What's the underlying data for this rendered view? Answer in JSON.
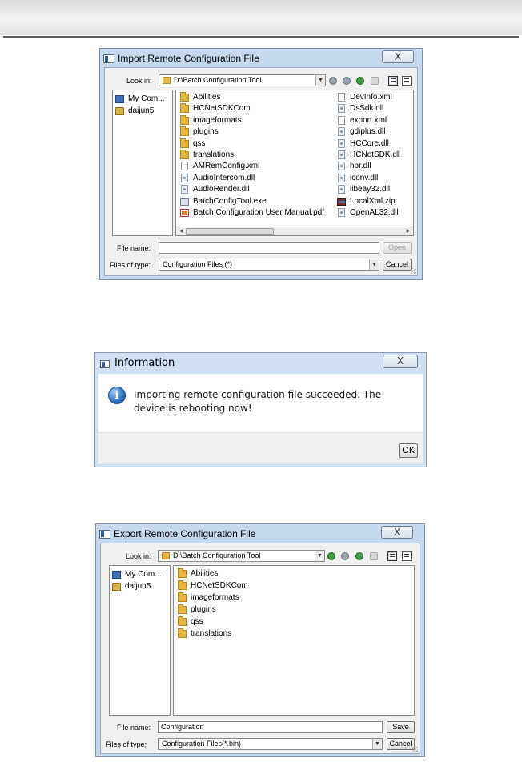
{
  "import_dialog": {
    "title": "Import Remote Configuration File",
    "close_glyph": "X",
    "look_in_label": "Look in:",
    "look_in_value": "D:\\Batch Configuration Tool",
    "sidebar": [
      "My Com...",
      "daijun5"
    ],
    "files_col1": [
      {
        "name": "Abilities",
        "icon": "folder-icon"
      },
      {
        "name": "HCNetSDKCom",
        "icon": "folder-icon"
      },
      {
        "name": "imageformats",
        "icon": "folder-icon"
      },
      {
        "name": "plugins",
        "icon": "folder-icon"
      },
      {
        "name": "qss",
        "icon": "folder-icon"
      },
      {
        "name": "translations",
        "icon": "folder-icon"
      },
      {
        "name": "AMRemConfig.xml",
        "icon": "file-icon"
      },
      {
        "name": "AudioIntercom.dll",
        "icon": "dll-icon"
      },
      {
        "name": "AudioRender.dll",
        "icon": "dll-icon"
      },
      {
        "name": "BatchConfigTool.exe",
        "icon": "exe-icon"
      },
      {
        "name": "Batch Configuration User Manual.pdf",
        "icon": "pdf-icon"
      }
    ],
    "files_col2": [
      {
        "name": "DevInfo.xml",
        "icon": "file-icon"
      },
      {
        "name": "DsSdk.dll",
        "icon": "dll-icon"
      },
      {
        "name": "export.xml",
        "icon": "file-icon"
      },
      {
        "name": "gdiplus.dll",
        "icon": "dll-icon"
      },
      {
        "name": "HCCore.dll",
        "icon": "dll-icon"
      },
      {
        "name": "HCNetSDK.dll",
        "icon": "dll-icon"
      },
      {
        "name": "hpr.dll",
        "icon": "dll-icon"
      },
      {
        "name": "iconv.dll",
        "icon": "dll-icon"
      },
      {
        "name": "libeay32.dll",
        "icon": "dll-icon"
      },
      {
        "name": "LocalXml.zip",
        "icon": "zip-icon"
      },
      {
        "name": "OpenAL32.dll",
        "icon": "dll-icon"
      }
    ],
    "file_name_label": "File name:",
    "file_name_value": "",
    "files_of_type_label": "Files of type:",
    "files_of_type_value": "Configuration Files (*)",
    "open_button": "Open",
    "cancel_button": "Cancel"
  },
  "info_dialog": {
    "title": "Information",
    "close_glyph": "X",
    "icon_glyph": "i",
    "message": "Importing remote configuration file succeeded. The device is rebooting now!",
    "ok_button": "OK"
  },
  "export_dialog": {
    "title": "Export Remote Configuration File",
    "close_glyph": "X",
    "look_in_label": "Look in:",
    "look_in_value": "D:\\Batch Configuration Tool",
    "sidebar": [
      "My Com...",
      "daijun5"
    ],
    "files": [
      "Abilities",
      "HCNetSDKCom",
      "imageformats",
      "plugins",
      "qss",
      "translations"
    ],
    "file_name_label": "File name:",
    "file_name_value": "Configuration",
    "files_of_type_label": "Files of type:",
    "files_of_type_value": "Configuration Files(*.bin)",
    "save_button": "Save",
    "cancel_button": "Cancel"
  }
}
